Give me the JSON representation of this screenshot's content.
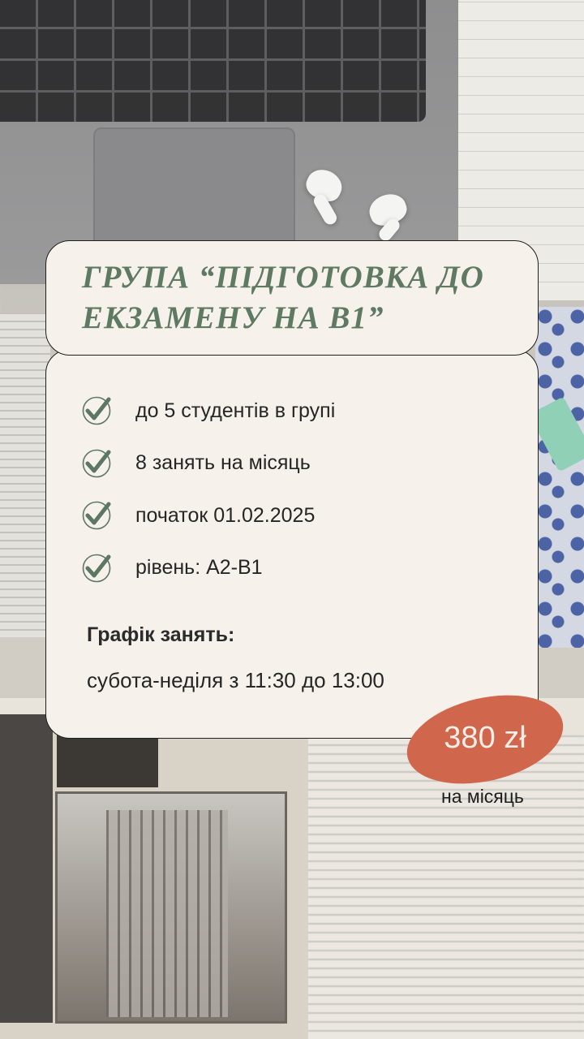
{
  "title": "ГРУПА “ПІДГОТОВКА ДО ЕКЗАМЕНУ НА B1”",
  "title_lines": [
    "ГРУПА “ПІДГОТОВКА ДО",
    "ЕКЗАМЕНУ НА B1”"
  ],
  "features": [
    {
      "icon": "checkmark-icon",
      "text": "до 5 студентів в групі"
    },
    {
      "icon": "checkmark-icon",
      "text": "8 занять на місяць"
    },
    {
      "icon": "checkmark-icon",
      "text": "початок 01.02.2025"
    },
    {
      "icon": "checkmark-icon",
      "text": "рівень: А2-В1"
    }
  ],
  "schedule": {
    "heading": "Графік занять:",
    "text": "субота-неділя з 11:30 до 13:00"
  },
  "price": {
    "value": "380 zł",
    "note": "на місяць"
  },
  "colors": {
    "title_green": "#5f7a62",
    "card_background": "#f6f1ea",
    "badge_orange": "#d0664b",
    "check_green": "#5c7762"
  }
}
